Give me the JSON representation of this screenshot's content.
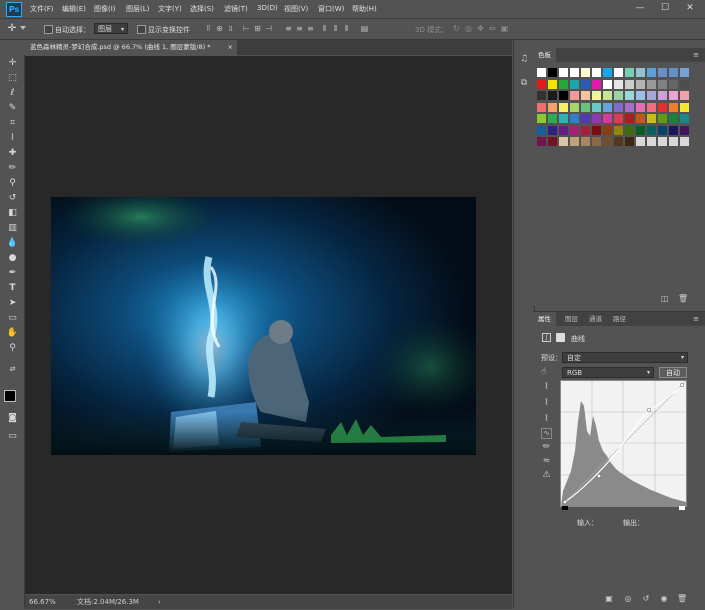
{
  "app": {
    "logo": "Ps"
  },
  "menu": [
    "文件(F)",
    "编辑(E)",
    "图像(I)",
    "图层(L)",
    "文字(Y)",
    "选择(S)",
    "滤镜(T)",
    "3D(D)",
    "视图(V)",
    "窗口(W)",
    "帮助(H)"
  ],
  "window_controls": {
    "minimize": "—",
    "maximize": "☐",
    "close": "✕"
  },
  "options": {
    "auto_select_label": "自动选择：",
    "auto_select_value": "图层",
    "show_transform_label": "显示变换控件",
    "mode_3d_label": "3D 模式："
  },
  "document_tab": {
    "title": "蓝色森林精灵-梦幻合成.psd @ 66.7% (曲线 1, 图层蒙版/8) *",
    "close": "×"
  },
  "status": {
    "zoom": "66.67%",
    "doc_info": "文档:2.04M/26.3M",
    "arrow": "›"
  },
  "swatches_panel": {
    "title": "色板"
  },
  "properties_panel": {
    "tabs": [
      "属性",
      "图层",
      "通道",
      "路径"
    ],
    "adjustment_name": "曲线",
    "preset_label": "预设：",
    "preset_value": "自定",
    "channel_value": "RGB",
    "auto_button": "自动",
    "input_label": "输入：",
    "output_label": "输出："
  },
  "swatch_colors": [
    [
      "#ffffff",
      "#000000",
      "#ffffff",
      "#ffffff",
      "#fefcd2",
      "#ffffff",
      "#1aa5e8",
      "#ffffff",
      "#74cfb4",
      "#94c4cf",
      "#5fa0d8",
      "#6a8ec8",
      "#6490c8",
      "#76a2d8"
    ],
    [
      "#e01b1b",
      "#f2e600",
      "#24a838",
      "#1aa8a6",
      "#2c58b6",
      "#e11aab",
      "#ffffff",
      "#e6e6e6",
      "#cccccc",
      "#b3b3b3",
      "#999999",
      "#808080",
      "#666666",
      "#4d4d4d"
    ],
    [
      "#333333",
      "#1a1a1a",
      "#000000",
      "#f29a9a",
      "#f5c49a",
      "#f8f29a",
      "#c9e49a",
      "#9ad3a9",
      "#9ad8d8",
      "#9abfe6",
      "#a9a3d8",
      "#c9a3d8",
      "#eda3cf",
      "#f2a3a9"
    ],
    [
      "#ef6e6e",
      "#f2a36a",
      "#f6ed6a",
      "#a9d46a",
      "#6ac17e",
      "#6ac7c7",
      "#6aa3dc",
      "#7e6ec7",
      "#a66ec7",
      "#e66eb5",
      "#ec6e80",
      "#e62e2e",
      "#ef7e2e",
      "#f4e82e"
    ],
    [
      "#8ccb2e",
      "#2eab52",
      "#2eb3b3",
      "#2e80cc",
      "#4f3ab3",
      "#8a3ab3",
      "#d83a9b",
      "#e03a55",
      "#b31a1a",
      "#c25a14",
      "#c9be14",
      "#5e9a14",
      "#14853a",
      "#148a8a"
    ],
    [
      "#14609e",
      "#2e2085",
      "#631f85",
      "#a61f72",
      "#a81f38",
      "#7a0e0e",
      "#8a3e0a",
      "#8f860a",
      "#3e6b0a",
      "#0a5c26",
      "#0a5f5f",
      "#0a426e",
      "#1c145c",
      "#44145c"
    ],
    [
      "#73144f",
      "#731426",
      "#d8c8a8",
      "#c2a078",
      "#a88660",
      "#8a6a46",
      "#6e5030",
      "#54381e",
      "#3c2812",
      "#d8d8d8",
      "#d8d8d8",
      "#d8d8d8",
      "#d8d8d8",
      "#d8d8d8"
    ]
  ]
}
